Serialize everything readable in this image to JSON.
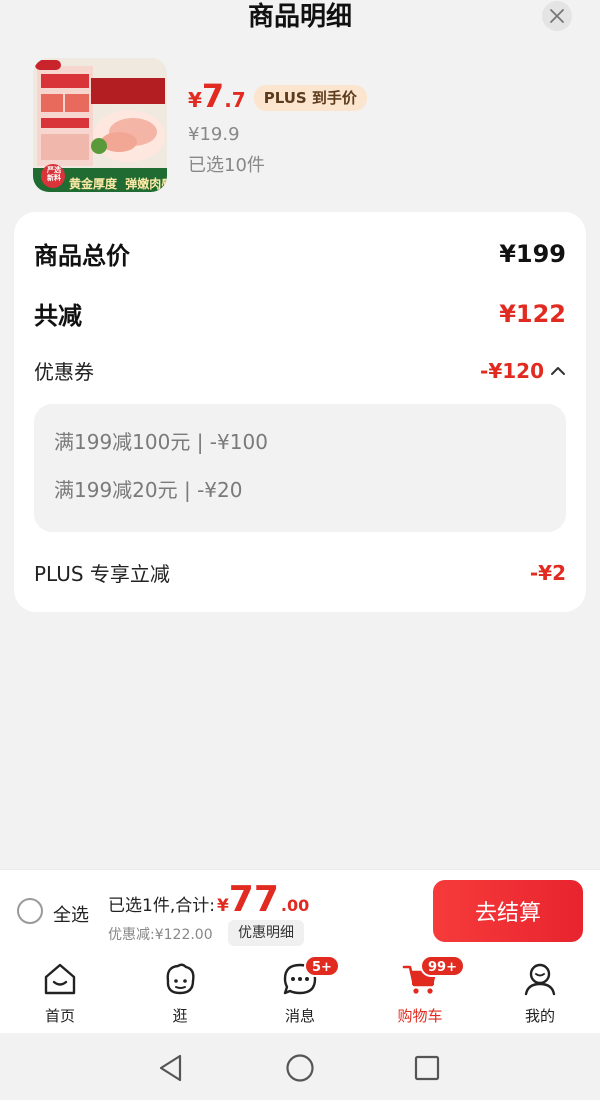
{
  "header": {
    "title": "商品明细"
  },
  "product": {
    "price_yen": "¥",
    "price_int": "7",
    "price_dec": ".7",
    "plus_tag": "PLUS 到手价",
    "original_price": "¥19.9",
    "selected_count": "已选10件",
    "image_caption_left": "黄金厚度",
    "image_caption_right": "弹嫩肉感",
    "image_badge": "严选 新料"
  },
  "summary": {
    "total_label": "商品总价",
    "total_value": "¥199",
    "reduce_label": "共减",
    "reduce_value": "¥122",
    "coupon_label": "优惠券",
    "coupon_value": "-¥120",
    "coupons": [
      "满199减100元 | -¥100",
      "满199减20元 | -¥20"
    ],
    "plus_label": "PLUS 专享立减",
    "plus_value": "-¥2"
  },
  "checkout": {
    "select_all": "全选",
    "sum_label": "已选1件,合计:",
    "sum_yen": "¥",
    "sum_int": "77",
    "sum_dec": ".00",
    "discount": "优惠减:¥122.00",
    "detail_button": "优惠明细",
    "checkout_button": "去结算"
  },
  "tabs": [
    {
      "label": "首页",
      "icon": "home-icon"
    },
    {
      "label": "逛",
      "icon": "browse-icon"
    },
    {
      "label": "消息",
      "icon": "message-icon",
      "badge": "5+"
    },
    {
      "label": "购物车",
      "icon": "cart-icon",
      "badge": "99+",
      "active": true
    },
    {
      "label": "我的",
      "icon": "profile-icon"
    }
  ],
  "colors": {
    "accent": "#e12b21",
    "plus_tag_bg": "#fbe5cf"
  }
}
